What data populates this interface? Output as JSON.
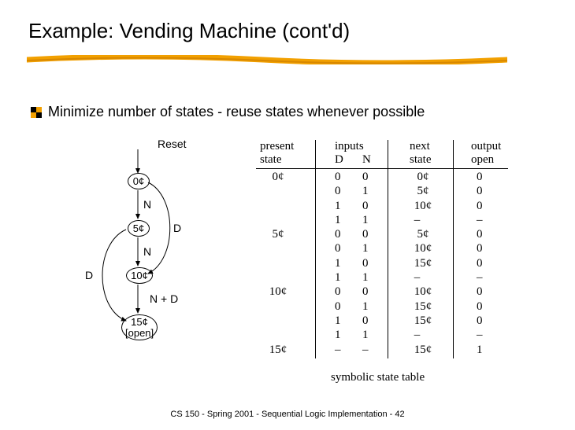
{
  "title": "Example: Vending Machine (cont'd)",
  "bullet": "Minimize number of states - reuse states whenever possible",
  "diagram": {
    "reset": "Reset",
    "s0": "0¢",
    "s5": "5¢",
    "s10": "10¢",
    "s15a": "15¢",
    "s15b": "[open]",
    "eN1": "N",
    "eN2": "N",
    "eD1": "D",
    "eD2": "D",
    "eND": "N + D"
  },
  "table": {
    "headers": {
      "present": "present\nstate",
      "inputs": "inputs",
      "D": "D",
      "N": "N",
      "next": "next\nstate",
      "output": "output",
      "open": "open"
    },
    "col_present": "  0¢\n\n\n\n  5¢\n\n\n\n 10¢\n\n\n\n 15¢",
    "col_D": "0\n0\n1\n1\n0\n0\n1\n1\n0\n0\n1\n1\n–",
    "col_N": "0\n1\n0\n1\n0\n1\n0\n1\n0\n1\n0\n1\n–",
    "col_next": "  0¢\n  5¢\n 10¢\n –\n  5¢\n 10¢\n 15¢\n –\n 10¢\n 15¢\n 15¢\n –\n 15¢",
    "col_open": "0\n0\n0\n–\n0\n0\n0\n–\n0\n0\n0\n–\n1"
  },
  "caption": "symbolic state table",
  "footer": "CS 150 - Spring  2001 - Sequential Logic Implementation - 42"
}
